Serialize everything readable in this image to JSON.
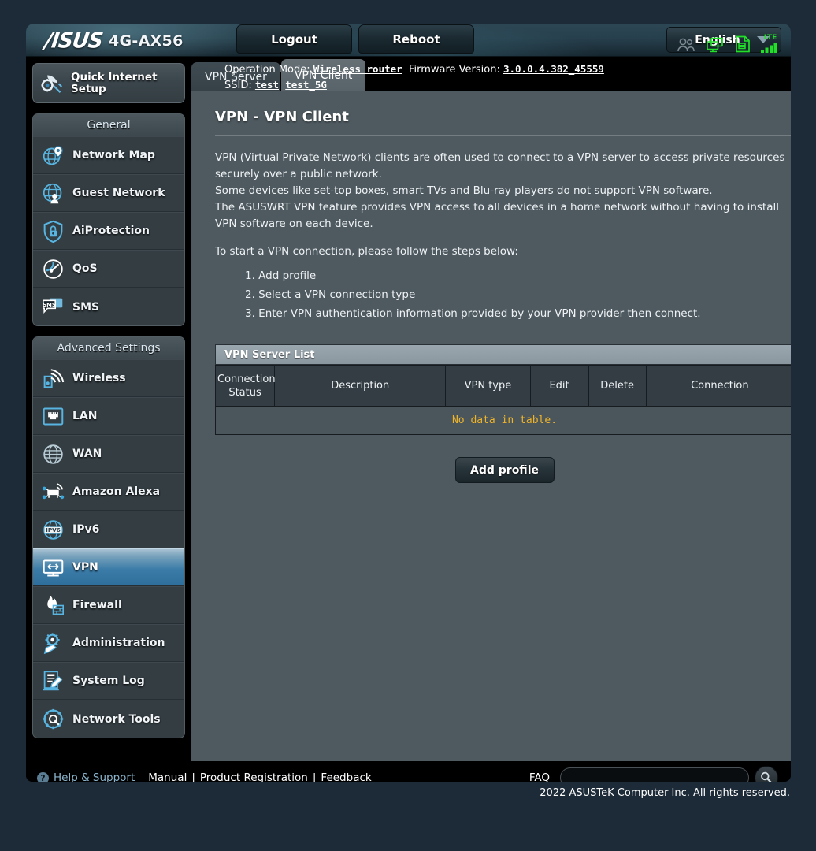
{
  "header": {
    "brand": "/ISUS",
    "model": "4G-AX56",
    "logout_label": "Logout",
    "reboot_label": "Reboot",
    "language": "English",
    "caret_icon": "chevron-down-icon"
  },
  "info_bar": {
    "operation_mode_label": "Operation Mode:",
    "operation_mode_value": "Wireless router",
    "firmware_label": "Firmware Version:",
    "firmware_value": "3.0.0.4.382_45559",
    "ssid_label": "SSID:",
    "ssid_value_1": "test",
    "ssid_value_2": "test_5G"
  },
  "status_icons": [
    {
      "name": "clients-icon",
      "color": "#7d8a93"
    },
    {
      "name": "usb-devices-icon",
      "color": "#22e02a"
    },
    {
      "name": "printer-icon",
      "color": "#22e02a"
    },
    {
      "name": "lte-signal-icon",
      "color": "#22e02a",
      "label": "LTE"
    }
  ],
  "sidebar": {
    "quick_internet_setup": {
      "line1": "Quick Internet",
      "line2": "Setup",
      "icon": "wizard-gear-icon"
    },
    "groups": [
      {
        "title": "General",
        "items": [
          {
            "label": "Network Map",
            "icon": "network-map-icon",
            "active": false
          },
          {
            "label": "Guest Network",
            "icon": "guest-network-icon",
            "active": false
          },
          {
            "label": "AiProtection",
            "icon": "shield-lock-icon",
            "active": false
          },
          {
            "label": "QoS",
            "icon": "speedometer-icon",
            "active": false
          },
          {
            "label": "SMS",
            "icon": "sms-icon",
            "active": false
          }
        ]
      },
      {
        "title": "Advanced Settings",
        "items": [
          {
            "label": "Wireless",
            "icon": "wifi-icon",
            "active": false
          },
          {
            "label": "LAN",
            "icon": "ethernet-icon",
            "active": false
          },
          {
            "label": "WAN",
            "icon": "globe-icon",
            "active": false
          },
          {
            "label": "Amazon Alexa",
            "icon": "alexa-icon",
            "active": false
          },
          {
            "label": "IPv6",
            "icon": "ipv6-icon",
            "active": false
          },
          {
            "label": "VPN",
            "icon": "vpn-icon",
            "active": true
          },
          {
            "label": "Firewall",
            "icon": "firewall-icon",
            "active": false
          },
          {
            "label": "Administration",
            "icon": "administration-icon",
            "active": false
          },
          {
            "label": "System Log",
            "icon": "system-log-icon",
            "active": false
          },
          {
            "label": "Network Tools",
            "icon": "network-tools-icon",
            "active": false
          }
        ]
      }
    ]
  },
  "tabs": [
    {
      "label": "VPN Server",
      "active": false
    },
    {
      "label": "VPN Client",
      "active": true
    }
  ],
  "main": {
    "page_title": "VPN - VPN Client",
    "description": [
      "VPN (Virtual Private Network) clients are often used to connect to a VPN server to access private resources securely over a public network.",
      "Some devices like set-top boxes, smart TVs and Blu-ray players do not support VPN software.",
      "The ASUSWRT VPN feature provides VPN access to all devices in a home network without having to install VPN software on each device."
    ],
    "steps_intro": "To start a VPN connection, please follow the steps below:",
    "steps": [
      "1. Add profile",
      "2. Select a VPN connection type",
      "3. Enter VPN authentication information provided by your VPN provider then connect."
    ],
    "table": {
      "caption": "VPN Server List",
      "columns": [
        "Connection Status",
        "Description",
        "VPN type",
        "Edit",
        "Delete",
        "Connection"
      ],
      "column_lines": [
        [
          "Connection",
          "Status"
        ],
        [
          "Description"
        ],
        [
          "VPN type"
        ],
        [
          "Edit"
        ],
        [
          "Delete"
        ],
        [
          "Connection"
        ]
      ],
      "rows": [],
      "empty_text": "No data in table.",
      "empty_text_color": "#f0b429"
    },
    "add_profile_label": "Add profile"
  },
  "footer": {
    "help_icon": "question-mark-icon",
    "help_label": "Help & Support",
    "links": [
      "Manual",
      "Product Registration",
      "Feedback"
    ],
    "separator": "|",
    "faq_label": "FAQ",
    "faq_placeholder": "",
    "faq_value": "",
    "search_icon": "search-icon",
    "copyright": "2022 ASUSTeK Computer Inc. All rights reserved."
  },
  "colors": {
    "outer_bg": "#1d2b38",
    "content_bg": "#4e5a60",
    "sidebar_bg": "#333d42",
    "accent_blue": "#2e6e9c",
    "warning_yellow": "#f0b429"
  }
}
